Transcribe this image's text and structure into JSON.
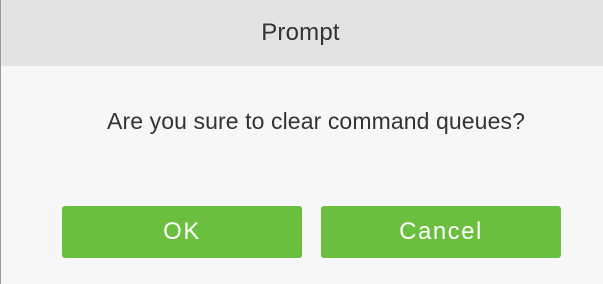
{
  "dialog": {
    "title": "Prompt",
    "message": "Are you sure to clear command queues?",
    "ok_label": "OK",
    "cancel_label": "Cancel"
  },
  "colors": {
    "title_bar_bg": "#e3e3e3",
    "dialog_bg": "#f7f7f7",
    "button_bg": "#6abf3f",
    "text": "#333333",
    "button_text": "#ffffff"
  }
}
